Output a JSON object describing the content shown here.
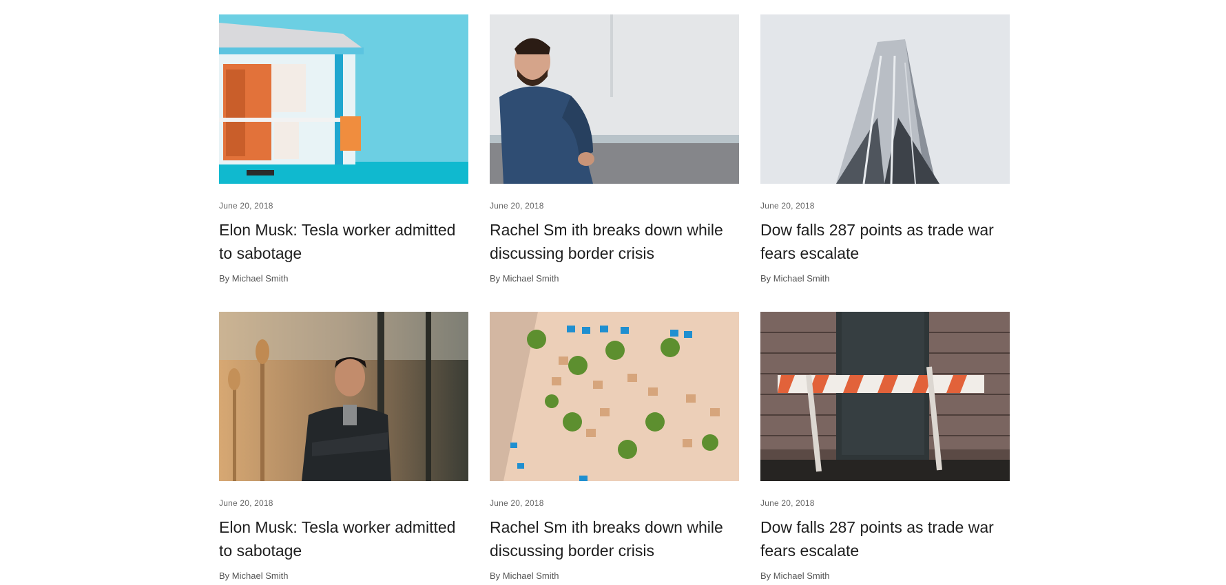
{
  "articles": [
    {
      "date": "June 20, 2018",
      "title": "Elon Musk: Tesla worker admitted to sabotage",
      "author": "By Michael Smith",
      "image": "lifeguard-tower-photo"
    },
    {
      "date": "June 20, 2018",
      "title": "Rachel Sm ith breaks down while discussing border crisis",
      "author": "By Michael Smith",
      "image": "bearded-man-photo"
    },
    {
      "date": "June 20, 2018",
      "title": "Dow falls 287 points as trade war fears escalate",
      "author": "By Michael Smith",
      "image": "skyscraper-photo"
    },
    {
      "date": "June 20, 2018",
      "title": "Elon Musk: Tesla worker admitted to sabotage",
      "author": "By Michael Smith",
      "image": "smiling-man-photo"
    },
    {
      "date": "June 20, 2018",
      "title": "Rachel Sm ith breaks down while discussing border crisis",
      "author": "By Michael Smith",
      "image": "aerial-beach-photo"
    },
    {
      "date": "June 20, 2018",
      "title": "Dow falls 287 points as trade war fears escalate",
      "author": "By Michael Smith",
      "image": "barricade-door-photo"
    }
  ],
  "colors": {
    "title": "#1e1e1e",
    "meta": "#666666",
    "sky_blue": "#6ccfe3",
    "sea": "#10b9cf",
    "orange": "#e2723a"
  }
}
